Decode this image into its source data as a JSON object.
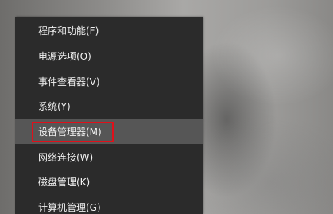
{
  "menu": {
    "items": [
      {
        "label": "程序和功能(F)"
      },
      {
        "label": "电源选项(O)"
      },
      {
        "label": "事件查看器(V)"
      },
      {
        "label": "系统(Y)"
      },
      {
        "label": "设备管理器(M)"
      },
      {
        "label": "网络连接(W)"
      },
      {
        "label": "磁盘管理(K)"
      },
      {
        "label": "计算机管理(G)"
      }
    ],
    "hovered_item": "设备管理器(M)",
    "highlight_color": "#e0101a",
    "background_color": "#2b2b2b",
    "hover_color": "#565656"
  }
}
